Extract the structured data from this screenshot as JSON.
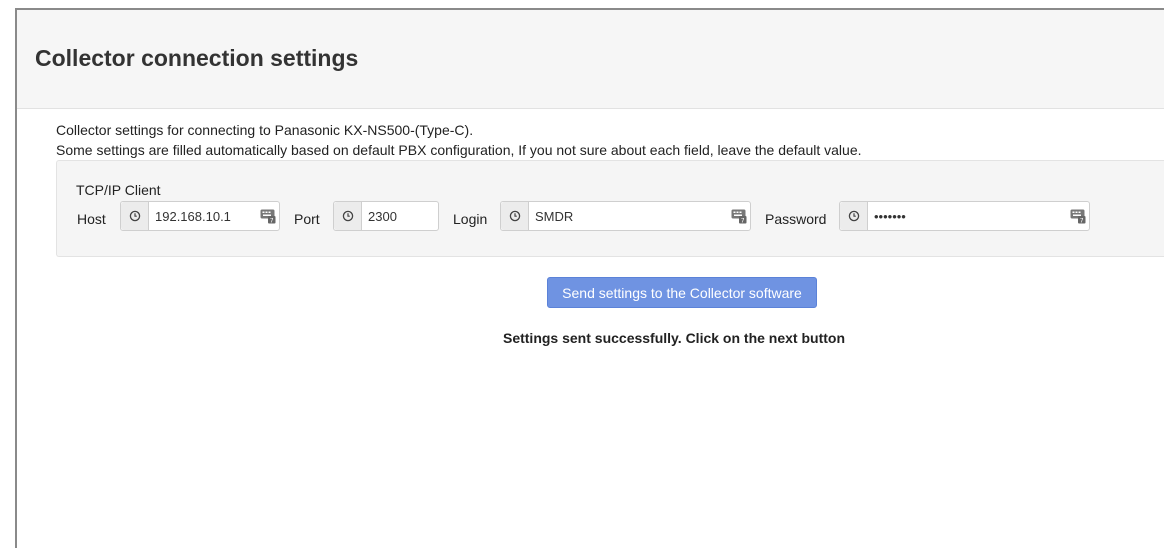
{
  "page": {
    "title": "Collector connection settings",
    "description_line1": "Collector settings for connecting to Panasonic KX-NS500-(Type-C).",
    "description_line2": "Some settings are filled automatically based on default PBX configuration, If you not sure about each field, leave the default value."
  },
  "panel": {
    "title": "TCP/IP Client",
    "fields": {
      "host": {
        "label": "Host",
        "value": "192.168.10.1",
        "icon": "clock-icon"
      },
      "port": {
        "label": "Port",
        "value": "2300",
        "icon": "clock-icon"
      },
      "login": {
        "label": "Login",
        "value": "SMDR",
        "icon": "clock-icon"
      },
      "password": {
        "label": "Password",
        "value": "1234567",
        "icon": "clock-icon"
      }
    }
  },
  "actions": {
    "send_label": "Send settings to the Collector software"
  },
  "status": {
    "message": "Settings sent successfully. Click on the next button"
  },
  "colors": {
    "button_bg": "#6f93e2",
    "header_bg": "#f6f6f6",
    "panel_bg": "#f5f5f5"
  }
}
